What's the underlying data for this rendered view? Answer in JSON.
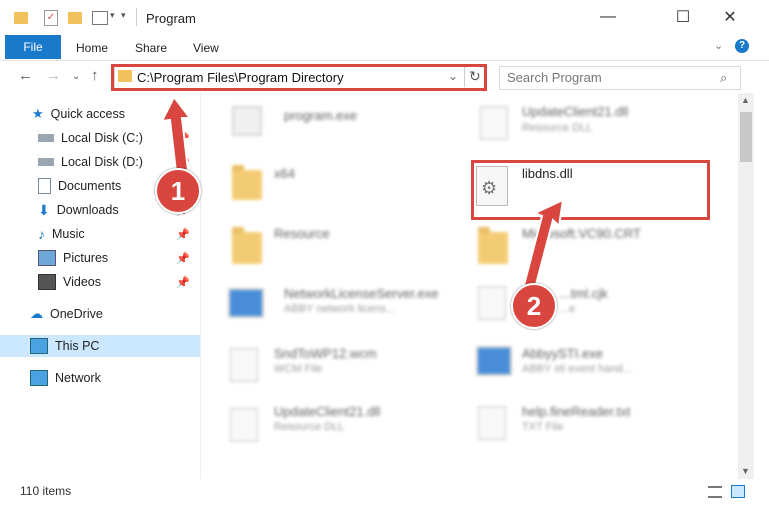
{
  "window": {
    "title": "Program",
    "controls": {
      "minimize": "—",
      "maximize": "☐",
      "close": "✕"
    }
  },
  "ribbon": {
    "tabs": {
      "file": "File",
      "home": "Home",
      "share": "Share",
      "view": "View"
    }
  },
  "address_bar": {
    "path": "C:\\Program Files\\Program Directory"
  },
  "search": {
    "placeholder": "Search Program"
  },
  "sidebar": {
    "items": [
      {
        "label": "Quick access",
        "icon": "star-icon"
      },
      {
        "label": "Local Disk (C:)",
        "icon": "drive-icon",
        "pinned": true
      },
      {
        "label": "Local Disk (D:)",
        "icon": "drive-icon",
        "pinned": true
      },
      {
        "label": "Documents",
        "icon": "documents-icon",
        "pinned": true
      },
      {
        "label": "Downloads",
        "icon": "downloads-icon",
        "pinned": true
      },
      {
        "label": "Music",
        "icon": "music-icon",
        "pinned": true
      },
      {
        "label": "Pictures",
        "icon": "pictures-icon",
        "pinned": true
      },
      {
        "label": "Videos",
        "icon": "videos-icon",
        "pinned": true
      },
      {
        "label": "OneDrive",
        "icon": "cloud-icon"
      },
      {
        "label": "This PC",
        "icon": "computer-icon",
        "selected": true
      },
      {
        "label": "Network",
        "icon": "network-icon"
      }
    ]
  },
  "files": {
    "left": [
      {
        "name": "program.exe",
        "sub": ""
      },
      {
        "name": "x64",
        "sub": ""
      },
      {
        "name": "Resource",
        "sub": ""
      },
      {
        "name": "NetworkLicenseServer.exe",
        "sub": "ABBY network licens..."
      },
      {
        "name": "SndToWP12.wcm",
        "sub": "WCM File"
      },
      {
        "name": "UpdateClient21.dll",
        "sub": "Resource DLL"
      }
    ],
    "right": [
      {
        "name": "UpdateClient21.dll",
        "sub": "Resource DLL"
      },
      {
        "name": "libdns.dll",
        "sub": ""
      },
      {
        "name": "Microsoft.VC90.CRT",
        "sub": ""
      },
      {
        "name": "...tml.cjk",
        "sub": "...e"
      },
      {
        "name": "AbbyySTI.exe",
        "sub": "ABBY sti event hand..."
      },
      {
        "name": "help.fineReader.txt",
        "sub": "TXT File"
      }
    ]
  },
  "status": {
    "item_count": "110 items"
  },
  "callouts": {
    "one": "1",
    "two": "2"
  },
  "colors": {
    "accent": "#1979ca",
    "highlight": "#d9463f",
    "folder": "#f2c35c"
  }
}
